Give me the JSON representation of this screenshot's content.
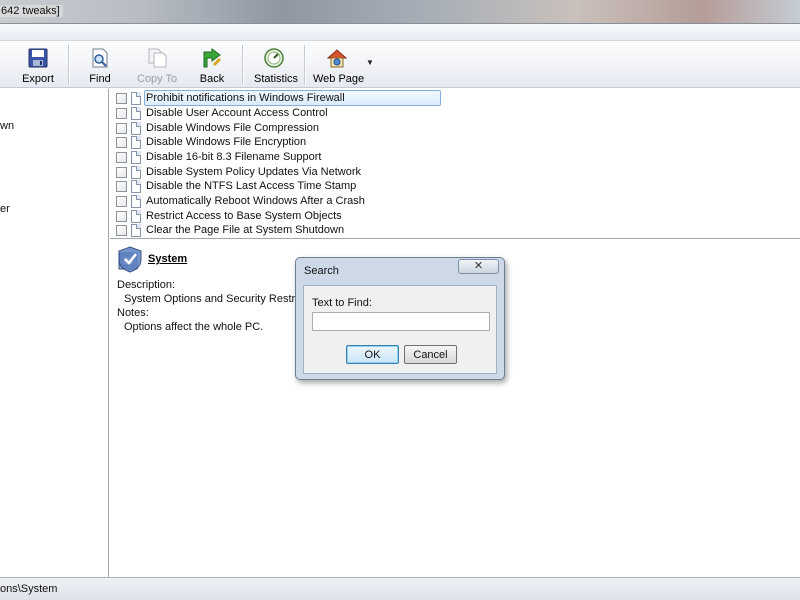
{
  "window": {
    "title_fragment": " 642 tweaks]"
  },
  "toolbar": {
    "export_label": "Export",
    "find_label": "Find",
    "copy_to_label": "Copy To",
    "back_label": "Back",
    "statistics_label": "Statistics",
    "web_page_label": "Web Page",
    "dropdown_arrow": "▼"
  },
  "left_pane": {
    "fragments": [
      "wn",
      "er"
    ]
  },
  "tweaks": [
    "Prohibit notifications in Windows Firewall",
    "Disable User Account Access Control",
    "Disable Windows File Compression",
    "Disable Windows File Encryption",
    "Disable 16-bit 8.3 Filename Support",
    "Disable System Policy Updates Via Network",
    "Disable the NTFS Last Access Time Stamp",
    "Automatically Reboot Windows After a Crash",
    "Restrict Access to Base System Objects",
    "Clear the Page File at System Shutdown"
  ],
  "detail": {
    "title": "System",
    "description_label": "Description:",
    "description_text": "System Options and Security Restrictions.",
    "notes_label": "Notes:",
    "notes_text": "Options affect the whole PC."
  },
  "status": {
    "path_fragment": "ons\\System"
  },
  "search_dialog": {
    "title": "Search",
    "close_glyph": "✕",
    "field_label": "Text to Find:",
    "field_value": "",
    "ok_label": "OK",
    "cancel_label": "Cancel"
  },
  "colors": {
    "selection_border": "#84acdd",
    "dialog_frame": "#cdd9e6"
  }
}
